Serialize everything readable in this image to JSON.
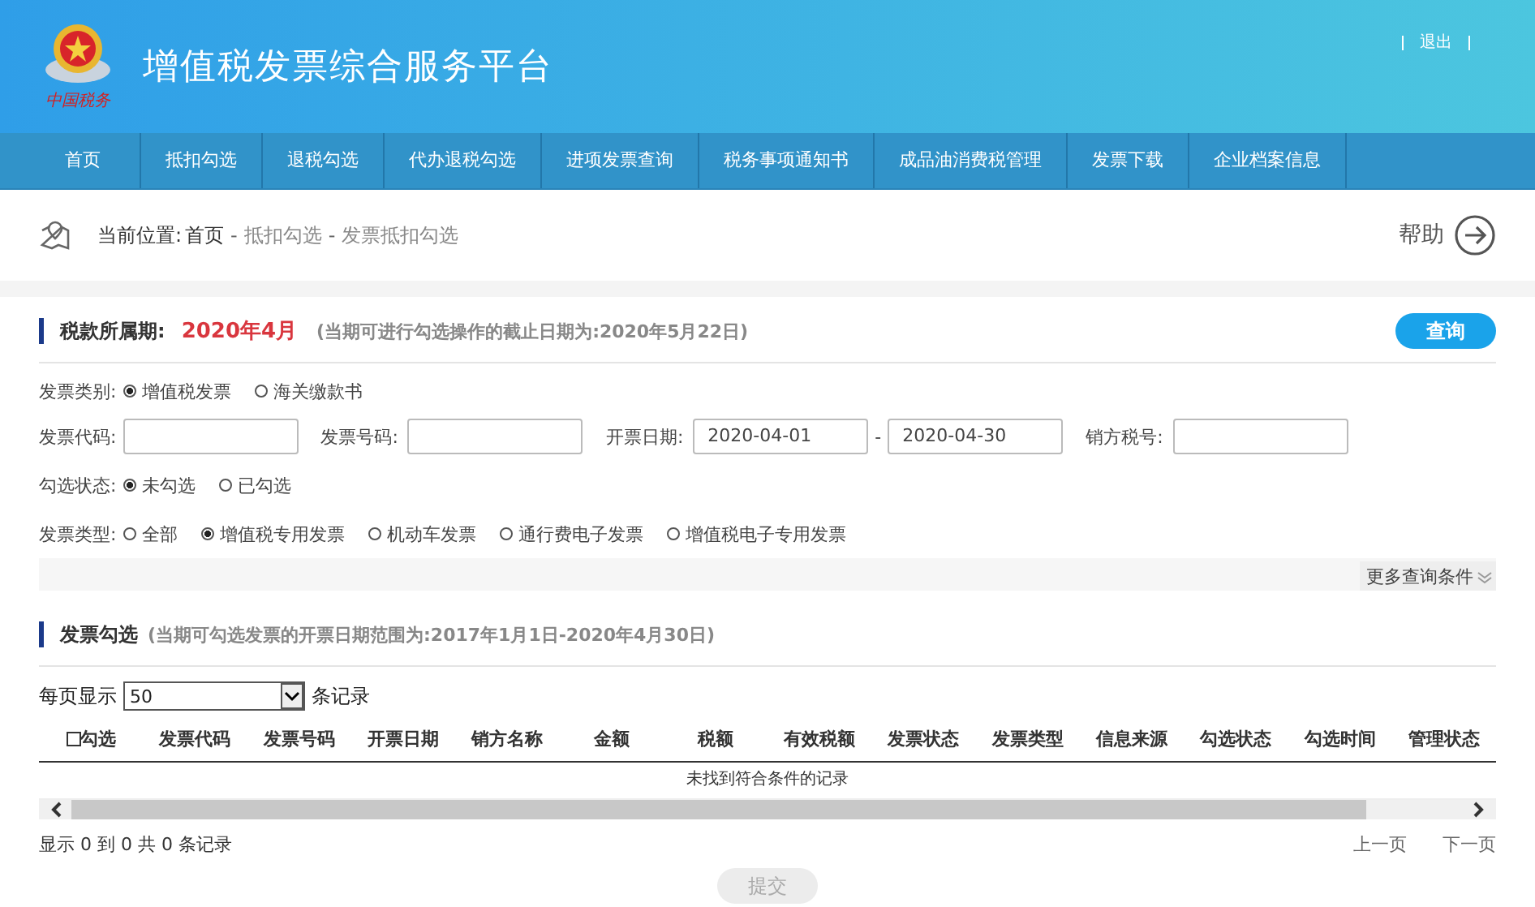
{
  "header": {
    "title": "增值税发票综合服务平台",
    "logo_text": "中国税务",
    "logout": "退出"
  },
  "nav": [
    {
      "label": "首页",
      "selected": false
    },
    {
      "label": "抵扣勾选",
      "selected": false
    },
    {
      "label": "退税勾选",
      "selected": false
    },
    {
      "label": "代办退税勾选",
      "selected": false
    },
    {
      "label": "进项发票查询",
      "selected": false
    },
    {
      "label": "税务事项通知书",
      "selected": false
    },
    {
      "label": "成品油消费税管理",
      "selected": false
    },
    {
      "label": "发票下载",
      "selected": false
    },
    {
      "label": "企业档案信息",
      "selected": false
    }
  ],
  "breadcrumb": {
    "label": "当前位置:",
    "items": [
      "首页",
      "抵扣勾选",
      "发票抵扣勾选"
    ],
    "separator": "-"
  },
  "help": "帮助",
  "period": {
    "label": "税款所属期:",
    "value": "2020年4月",
    "note": "(当期可进行勾选操作的截止日期为:2020年5月22日)",
    "query_button": "查询"
  },
  "filters": {
    "invoice_category": {
      "label": "发票类别:",
      "options": [
        {
          "label": "增值税发票",
          "selected": true
        },
        {
          "label": "海关缴款书",
          "selected": false
        }
      ]
    },
    "fields": [
      {
        "label": "发票代码:"
      },
      {
        "label": "发票号码:"
      },
      {
        "label": "开票日期:",
        "value": "2020-04-01",
        "separator": "-",
        "value_to": "2020-04-30"
      },
      {
        "label": "销方税号:"
      }
    ],
    "select_status": {
      "label": "勾选状态:",
      "options": [
        {
          "label": "未勾选",
          "selected": true
        },
        {
          "label": "已勾选",
          "selected": false
        }
      ]
    },
    "invoice_type": {
      "label": "发票类型:",
      "options": [
        {
          "label": "全部",
          "selected": false
        },
        {
          "label": "增值税专用发票",
          "selected": true
        },
        {
          "label": "机动车发票",
          "selected": false
        },
        {
          "label": "通行费电子发票",
          "selected": false
        },
        {
          "label": "增值税电子专用发票",
          "selected": false
        }
      ]
    },
    "more": "更多查询条件"
  },
  "selection": {
    "title": "发票勾选",
    "note": "(当期可勾选发票的开票日期范围为:2017年1月1日-2020年4月30日)",
    "page_size_label": "每页显示",
    "page_size": "50",
    "records_label": "条记录",
    "columns": [
      {
        "label": "勾选",
        "checked": false
      },
      {
        "label": "发票代码"
      },
      {
        "label": "发票号码"
      },
      {
        "label": "开票日期"
      },
      {
        "label": "销方名称"
      },
      {
        "label": "金额"
      },
      {
        "label": "税额"
      },
      {
        "label": "有效税额"
      },
      {
        "label": "发票状态"
      },
      {
        "label": "发票类型"
      },
      {
        "label": "信息来源"
      },
      {
        "label": "勾选状态"
      },
      {
        "label": "勾选时间"
      },
      {
        "label": "管理状态"
      }
    ],
    "empty": "未找到符合条件的记录",
    "summary": "显示 0 到 0 共 0 条记录",
    "prev": "上一页",
    "next": "下一页",
    "submit": "提交",
    "submit_disabled": true
  }
}
